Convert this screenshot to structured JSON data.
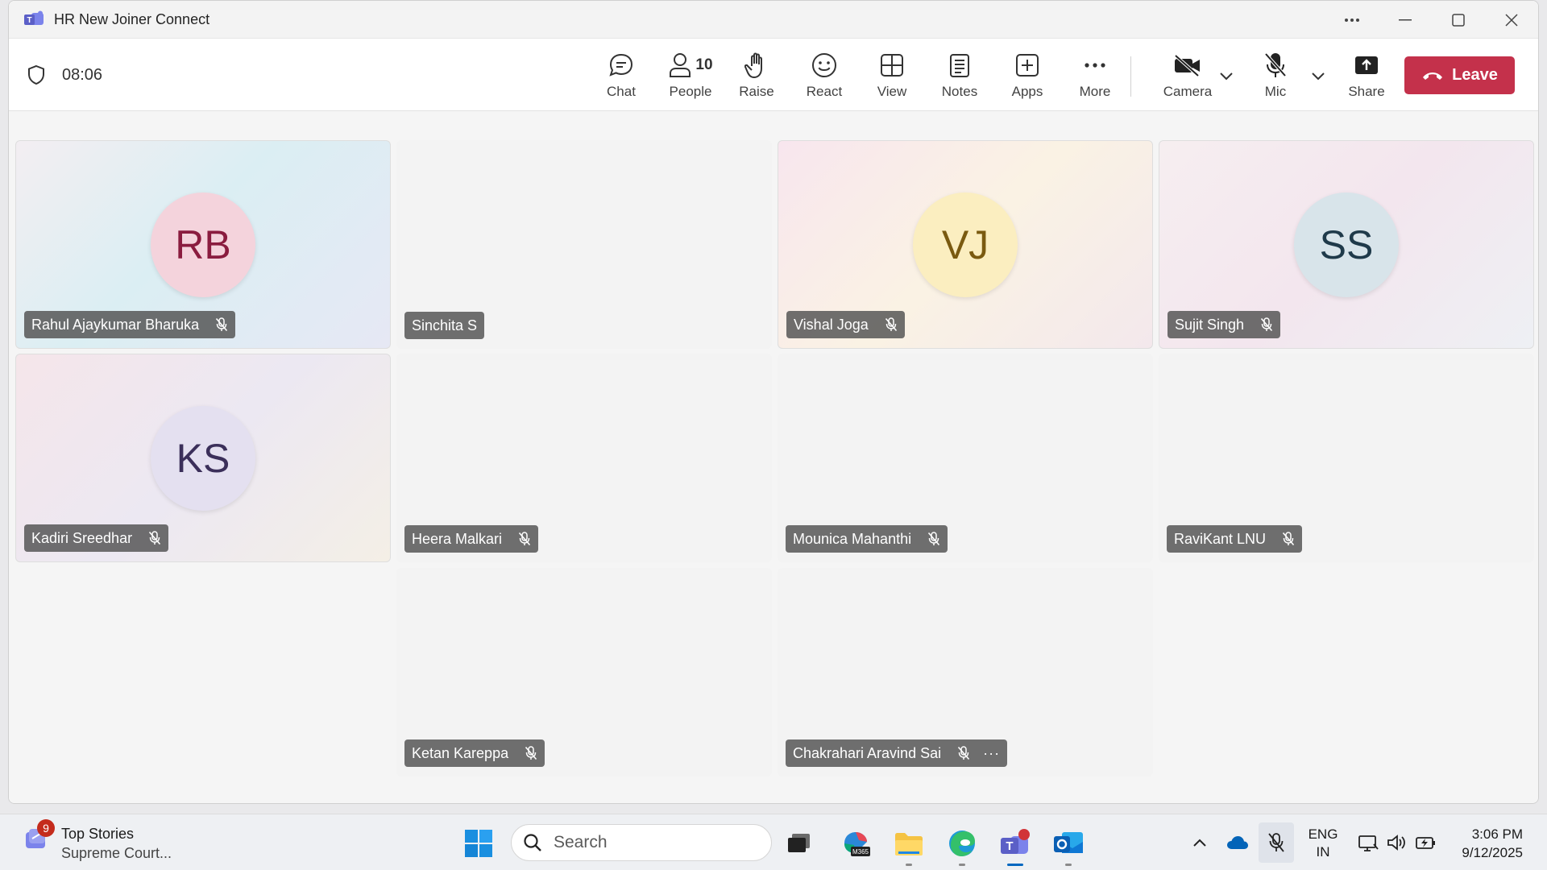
{
  "window": {
    "title": "HR New Joiner Connect"
  },
  "toolbar": {
    "timer": "08:06",
    "items": [
      {
        "id": "chat",
        "label": "Chat",
        "icon": "chat-icon"
      },
      {
        "id": "people",
        "label": "People",
        "icon": "people-icon",
        "count": "10"
      },
      {
        "id": "raise",
        "label": "Raise",
        "icon": "raise-hand-icon"
      },
      {
        "id": "react",
        "label": "React",
        "icon": "smiley-icon"
      },
      {
        "id": "view",
        "label": "View",
        "icon": "grid-view-icon"
      },
      {
        "id": "notes",
        "label": "Notes",
        "icon": "notes-icon"
      },
      {
        "id": "apps",
        "label": "Apps",
        "icon": "add-apps-icon"
      },
      {
        "id": "more",
        "label": "More",
        "icon": "more-horizontal-icon"
      },
      {
        "id": "camera",
        "label": "Camera",
        "icon": "camera-off-icon"
      },
      {
        "id": "mic",
        "label": "Mic",
        "icon": "mic-off-icon"
      },
      {
        "id": "share",
        "label": "Share",
        "icon": "share-tray-icon"
      }
    ],
    "leave_label": "Leave"
  },
  "participants": [
    {
      "name": "Rahul Ajaykumar Bharuka",
      "initials": "RB",
      "muted": true
    },
    {
      "name": "Sinchita S",
      "initials": "",
      "muted": false
    },
    {
      "name": "Vishal Joga",
      "initials": "VJ",
      "muted": true
    },
    {
      "name": "Sujit Singh",
      "initials": "SS",
      "muted": true
    },
    {
      "name": "Kadiri Sreedhar",
      "initials": "KS",
      "muted": true
    },
    {
      "name": "Heera Malkari",
      "initials": "",
      "muted": true
    },
    {
      "name": "Mounica Mahanthi",
      "initials": "",
      "muted": true
    },
    {
      "name": "RaviKant LNU",
      "initials": "",
      "muted": true
    },
    {
      "name": "Ketan Kareppa",
      "initials": "",
      "muted": true
    },
    {
      "name": "Chakrahari Aravind Sai",
      "initials": "",
      "muted": true,
      "more": "···"
    }
  ],
  "taskbar": {
    "news_title": "Top Stories",
    "news_subtitle": "Supreme Court...",
    "news_badge": "9",
    "search_placeholder": "Search",
    "lang_line1": "ENG",
    "lang_line2": "IN",
    "time": "3:06 PM",
    "date": "9/12/2025"
  },
  "colors": {
    "leave": "#c4314b",
    "teams": "#5b5fc7",
    "rb_avatar_bg": "#f4d3dc",
    "rb_avatar_fg": "#8a1c3f",
    "vj_avatar_bg": "#fbeec0",
    "vj_avatar_fg": "#7a5a10",
    "ss_avatar_bg": "#d8e4ea",
    "ss_avatar_fg": "#1f3a4a",
    "ks_avatar_bg": "#e4e0f0",
    "ks_avatar_fg": "#3b2f5a"
  }
}
